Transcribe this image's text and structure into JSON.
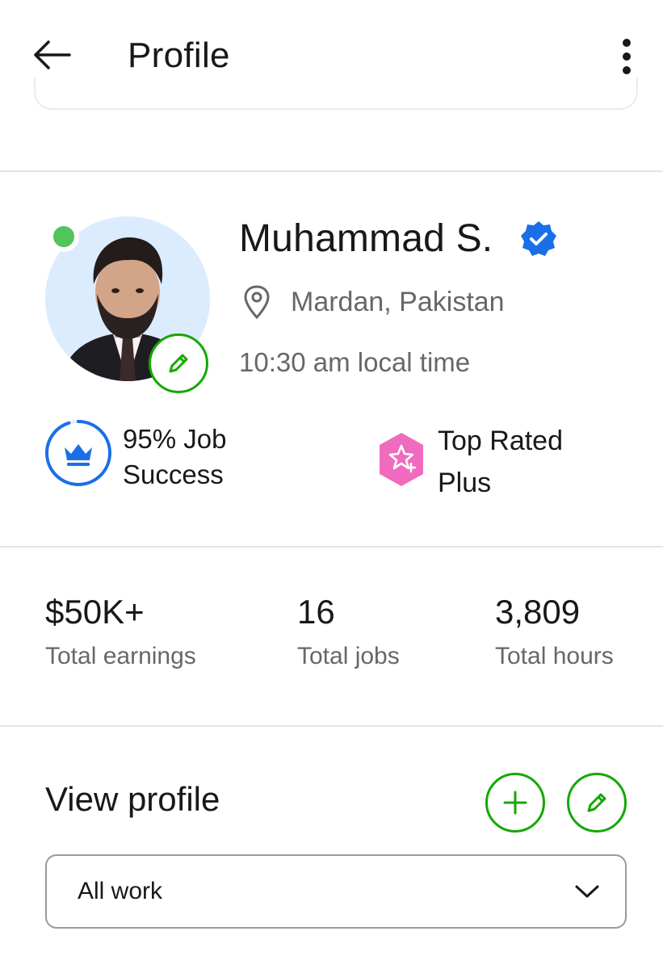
{
  "header": {
    "title": "Profile",
    "back_icon": "arrow-left-icon",
    "more_icon": "more-vertical-icon"
  },
  "profile": {
    "name": "Muhammad S.",
    "verified_icon": "verified-badge-icon",
    "location": "Mardan, Pakistan",
    "location_icon": "map-pin-icon",
    "local_time": "10:30 am local time",
    "online_status": "online",
    "avatar_edit_icon": "pencil-icon"
  },
  "badges": {
    "job_success": {
      "line1": "95% Job",
      "line2": "Success",
      "percent": 95,
      "icon": "crown-icon"
    },
    "top_rated": {
      "line1": "Top Rated",
      "line2": "Plus",
      "icon": "star-plus-icon"
    }
  },
  "stats": [
    {
      "value": "$50K+",
      "label": "Total earnings"
    },
    {
      "value": "16",
      "label": "Total jobs"
    },
    {
      "value": "3,809",
      "label": "Total hours"
    }
  ],
  "view_profile": {
    "title": "View profile",
    "add_icon": "plus-icon",
    "edit_icon": "pencil-icon",
    "dropdown": {
      "selected": "All work",
      "icon": "chevron-down-icon"
    }
  },
  "colors": {
    "accent_green": "#14a800",
    "online_green": "#52c45c",
    "verified_blue": "#1a6fe8",
    "jss_blue": "#1a6fe8",
    "top_rated_pink": "#f06bbd",
    "muted_text": "#676767"
  }
}
